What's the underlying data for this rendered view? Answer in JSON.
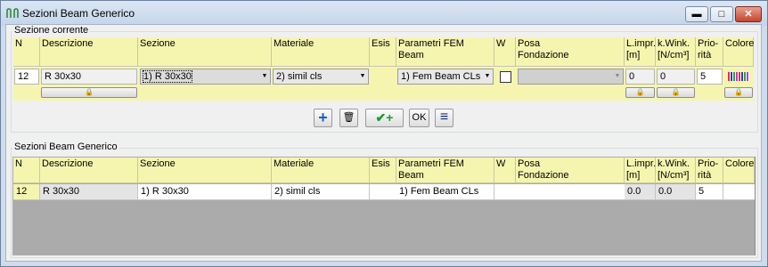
{
  "window": {
    "title": "Sezioni Beam Generico",
    "buttons": {
      "minimize": "▬",
      "maximize": "□",
      "close": "✕"
    }
  },
  "current": {
    "group_label": "Sezione corrente",
    "headers": {
      "n": "N",
      "descrizione": "Descrizione",
      "sezione": "Sezione",
      "materiale": "Materiale",
      "esis": "Esis",
      "fem1": "Parametri FEM",
      "fem2": "Beam",
      "w": "W",
      "posa1": "Posa",
      "posa2": "Fondazione",
      "limpr1": "L.impr.",
      "limpr2": "[m]",
      "kwink1": "k.Wink.",
      "kwink2": "[N/cm³]",
      "prio1": "Prio-",
      "prio2": "rità",
      "colore": "Colore"
    },
    "row": {
      "n": "12",
      "descrizione": "R 30x30",
      "sezione": "1) R 30x30",
      "materiale": "2) simil cls",
      "fem": "1) Fem Beam CLs",
      "posa": "",
      "limpr": "0",
      "kwink": "0",
      "priorita": "5"
    },
    "lock_glyph": "🔒"
  },
  "toolbar": {
    "add_icon": "+",
    "delete_icon": "🗑",
    "ok_add_icon": "✔+",
    "ok_label": "OK",
    "list_icon": "≡"
  },
  "list": {
    "group_label": "Sezioni Beam Generico",
    "headers": {
      "n": "N",
      "descrizione": "Descrizione",
      "sezione": "Sezione",
      "materiale": "Materiale",
      "esis": "Esis",
      "fem1": "Parametri FEM",
      "fem2": "Beam",
      "w": "W",
      "posa1": "Posa",
      "posa2": "Fondazione",
      "limpr1": "L.impr.",
      "limpr2": "[m]",
      "kwink1": "k.Wink.",
      "kwink2": "[N/cm³]",
      "prio1": "Prio-",
      "prio2": "rità",
      "colore": "Colore"
    },
    "rows": [
      {
        "n": "12",
        "descrizione": "R 30x30",
        "sezione": "1) R 30x30",
        "materiale": "2) simil cls",
        "esis": "",
        "fem": "1) Fem Beam CLs",
        "w": "",
        "posa": "",
        "limpr": "0.0",
        "kwink": "0.0",
        "priorita": "5"
      }
    ]
  }
}
